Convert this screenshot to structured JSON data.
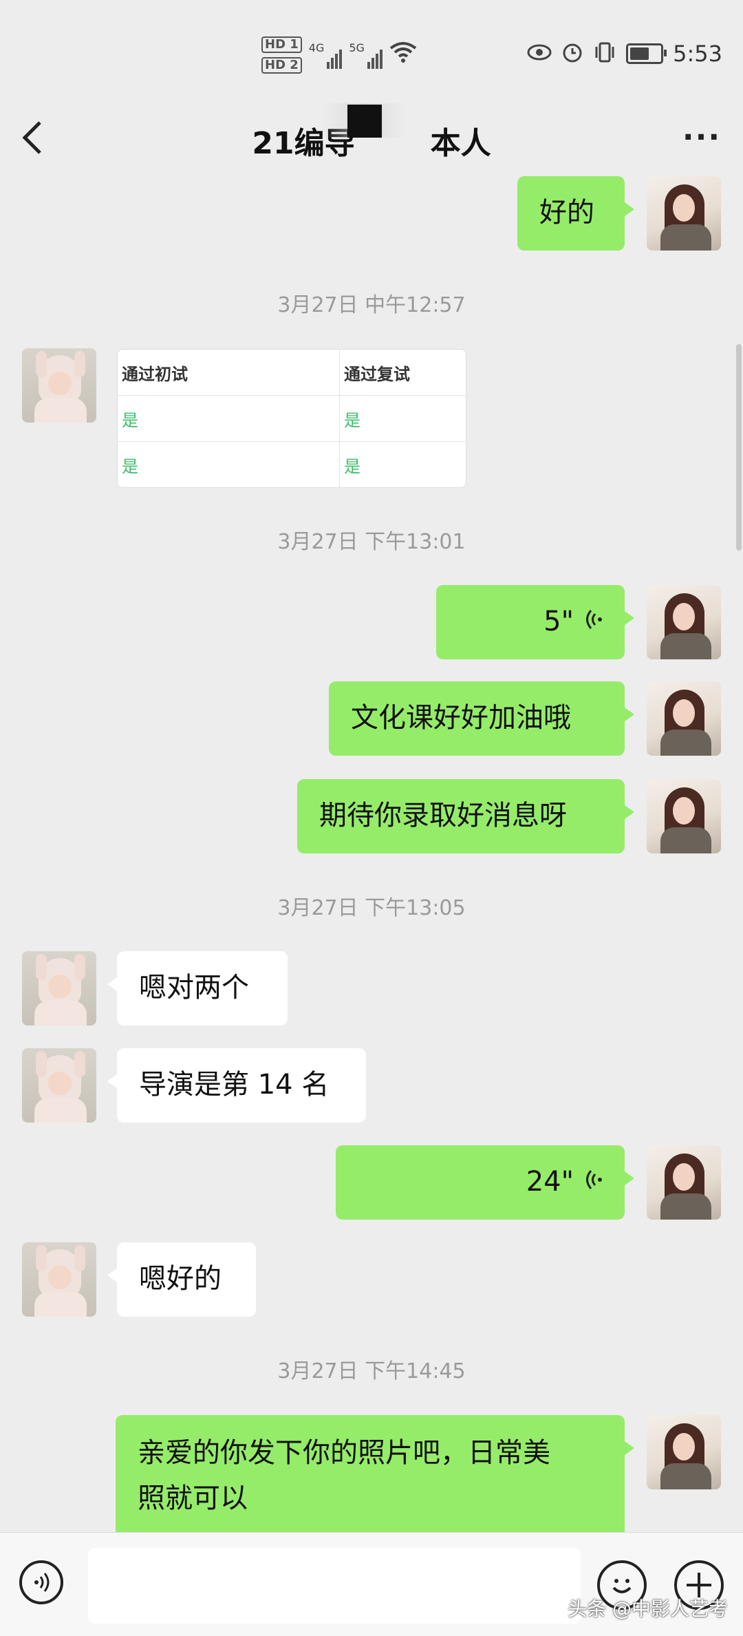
{
  "status_bar": {
    "hd1": "HD 1",
    "hd2": "HD 2",
    "net1": "4G",
    "net2": "5G",
    "time": "5:53"
  },
  "header": {
    "title": "21编导",
    "title_tail": "本人",
    "more_label": "···"
  },
  "messages": {
    "m1": {
      "text": "好的"
    },
    "t1": "3月27日 中午12:57",
    "table": {
      "headers": [
        "通过初试",
        "通过复试"
      ],
      "rows": [
        [
          "是",
          "是"
        ],
        [
          "是",
          "是"
        ]
      ]
    },
    "t2": "3月27日 下午13:01",
    "m2": {
      "duration": "5\""
    },
    "m3": {
      "text": "文化课好好加油哦"
    },
    "m4": {
      "text": "期待你录取好消息呀"
    },
    "t3": "3月27日 下午13:05",
    "m5": {
      "text": "嗯对两个"
    },
    "m6": {
      "text": "导演是第 14 名"
    },
    "m7": {
      "duration": "24\""
    },
    "m8": {
      "text": "嗯好的"
    },
    "t4": "3月27日 下午14:45",
    "m9": {
      "line1": "亲爱的你发下你的照片吧，日常美",
      "line2": "照就可以"
    }
  },
  "watermark": "头条 @中影人艺考",
  "icons": [
    "back-icon",
    "more-icon",
    "voice-wave-icon",
    "voice-input-icon",
    "emoji-icon",
    "plus-icon",
    "wifi-icon",
    "eye-icon",
    "alarm-icon",
    "vibrate-icon",
    "battery-icon"
  ]
}
